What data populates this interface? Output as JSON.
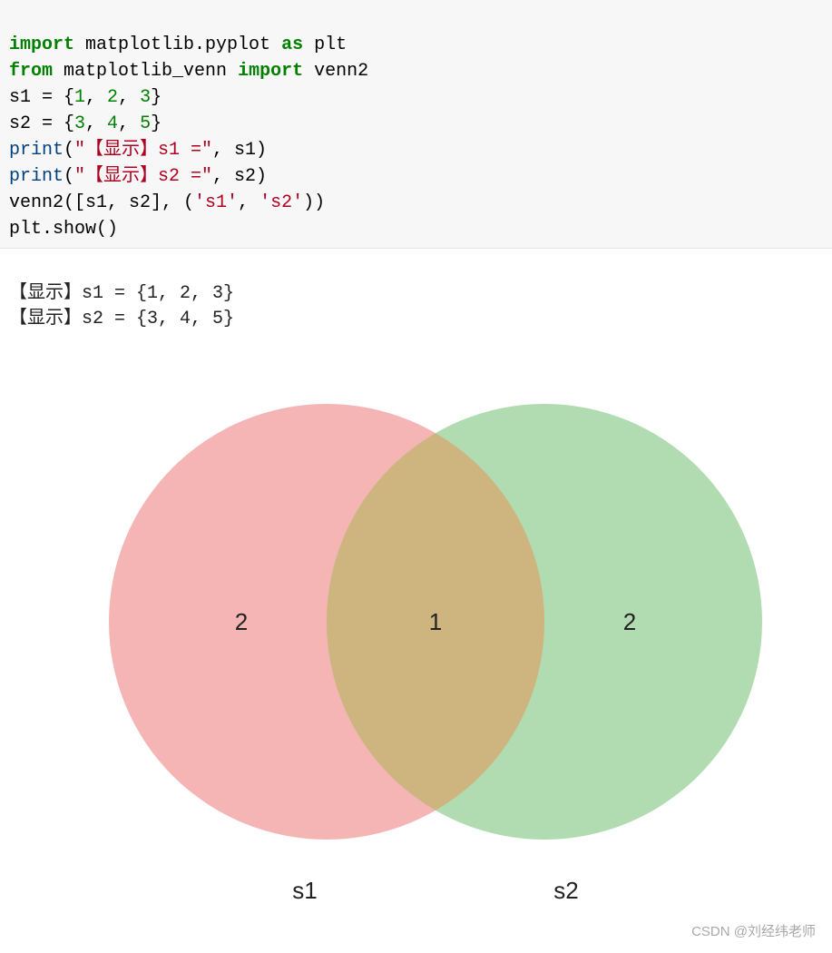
{
  "code": {
    "l1": {
      "kw1": "import",
      "mod": " matplotlib.pyplot ",
      "kw2": "as",
      "alias": " plt"
    },
    "l2": {
      "kw1": "from",
      "mod": " matplotlib_venn ",
      "kw2": "import",
      "name": " venn2"
    },
    "l3": {
      "pre": "s1 = {",
      "n1": "1",
      "c1": ", ",
      "n2": "2",
      "c2": ", ",
      "n3": "3",
      "post": "}"
    },
    "l4": {
      "pre": "s2 = {",
      "n1": "3",
      "c1": ", ",
      "n2": "4",
      "c2": ", ",
      "n3": "5",
      "post": "}"
    },
    "l5": {
      "fn": "print",
      "open": "(",
      "str": "\"【显示】s1 =\"",
      "rest": ", s1)"
    },
    "l6": {
      "fn": "print",
      "open": "(",
      "str": "\"【显示】s2 =\"",
      "rest": ", s2)"
    },
    "l7": {
      "pre": "venn2([s1, s2], (",
      "s1": "'s1'",
      "comma": ", ",
      "s2": "'s2'",
      "post": "))"
    },
    "l8": {
      "text": "plt.show()"
    }
  },
  "output": {
    "line1": "【显示】s1 = {1, 2, 3}",
    "line2": "【显示】s2 = {3, 4, 5}"
  },
  "chart_data": {
    "type": "venn",
    "sets": [
      {
        "name": "s1",
        "only_count": 2
      },
      {
        "name": "s2",
        "only_count": 2
      }
    ],
    "intersection_count": 1,
    "labels": {
      "left": "s1",
      "right": "s2",
      "leftCount": "2",
      "midCount": "1",
      "rightCount": "2"
    },
    "colors": {
      "left": "#f28e8e",
      "right": "#8ecf8e",
      "leftFill": "#f4a0a0",
      "rightFill": "#9bd19b",
      "overlap": "#d3b27a"
    }
  },
  "watermark": "CSDN @刘经纬老师"
}
